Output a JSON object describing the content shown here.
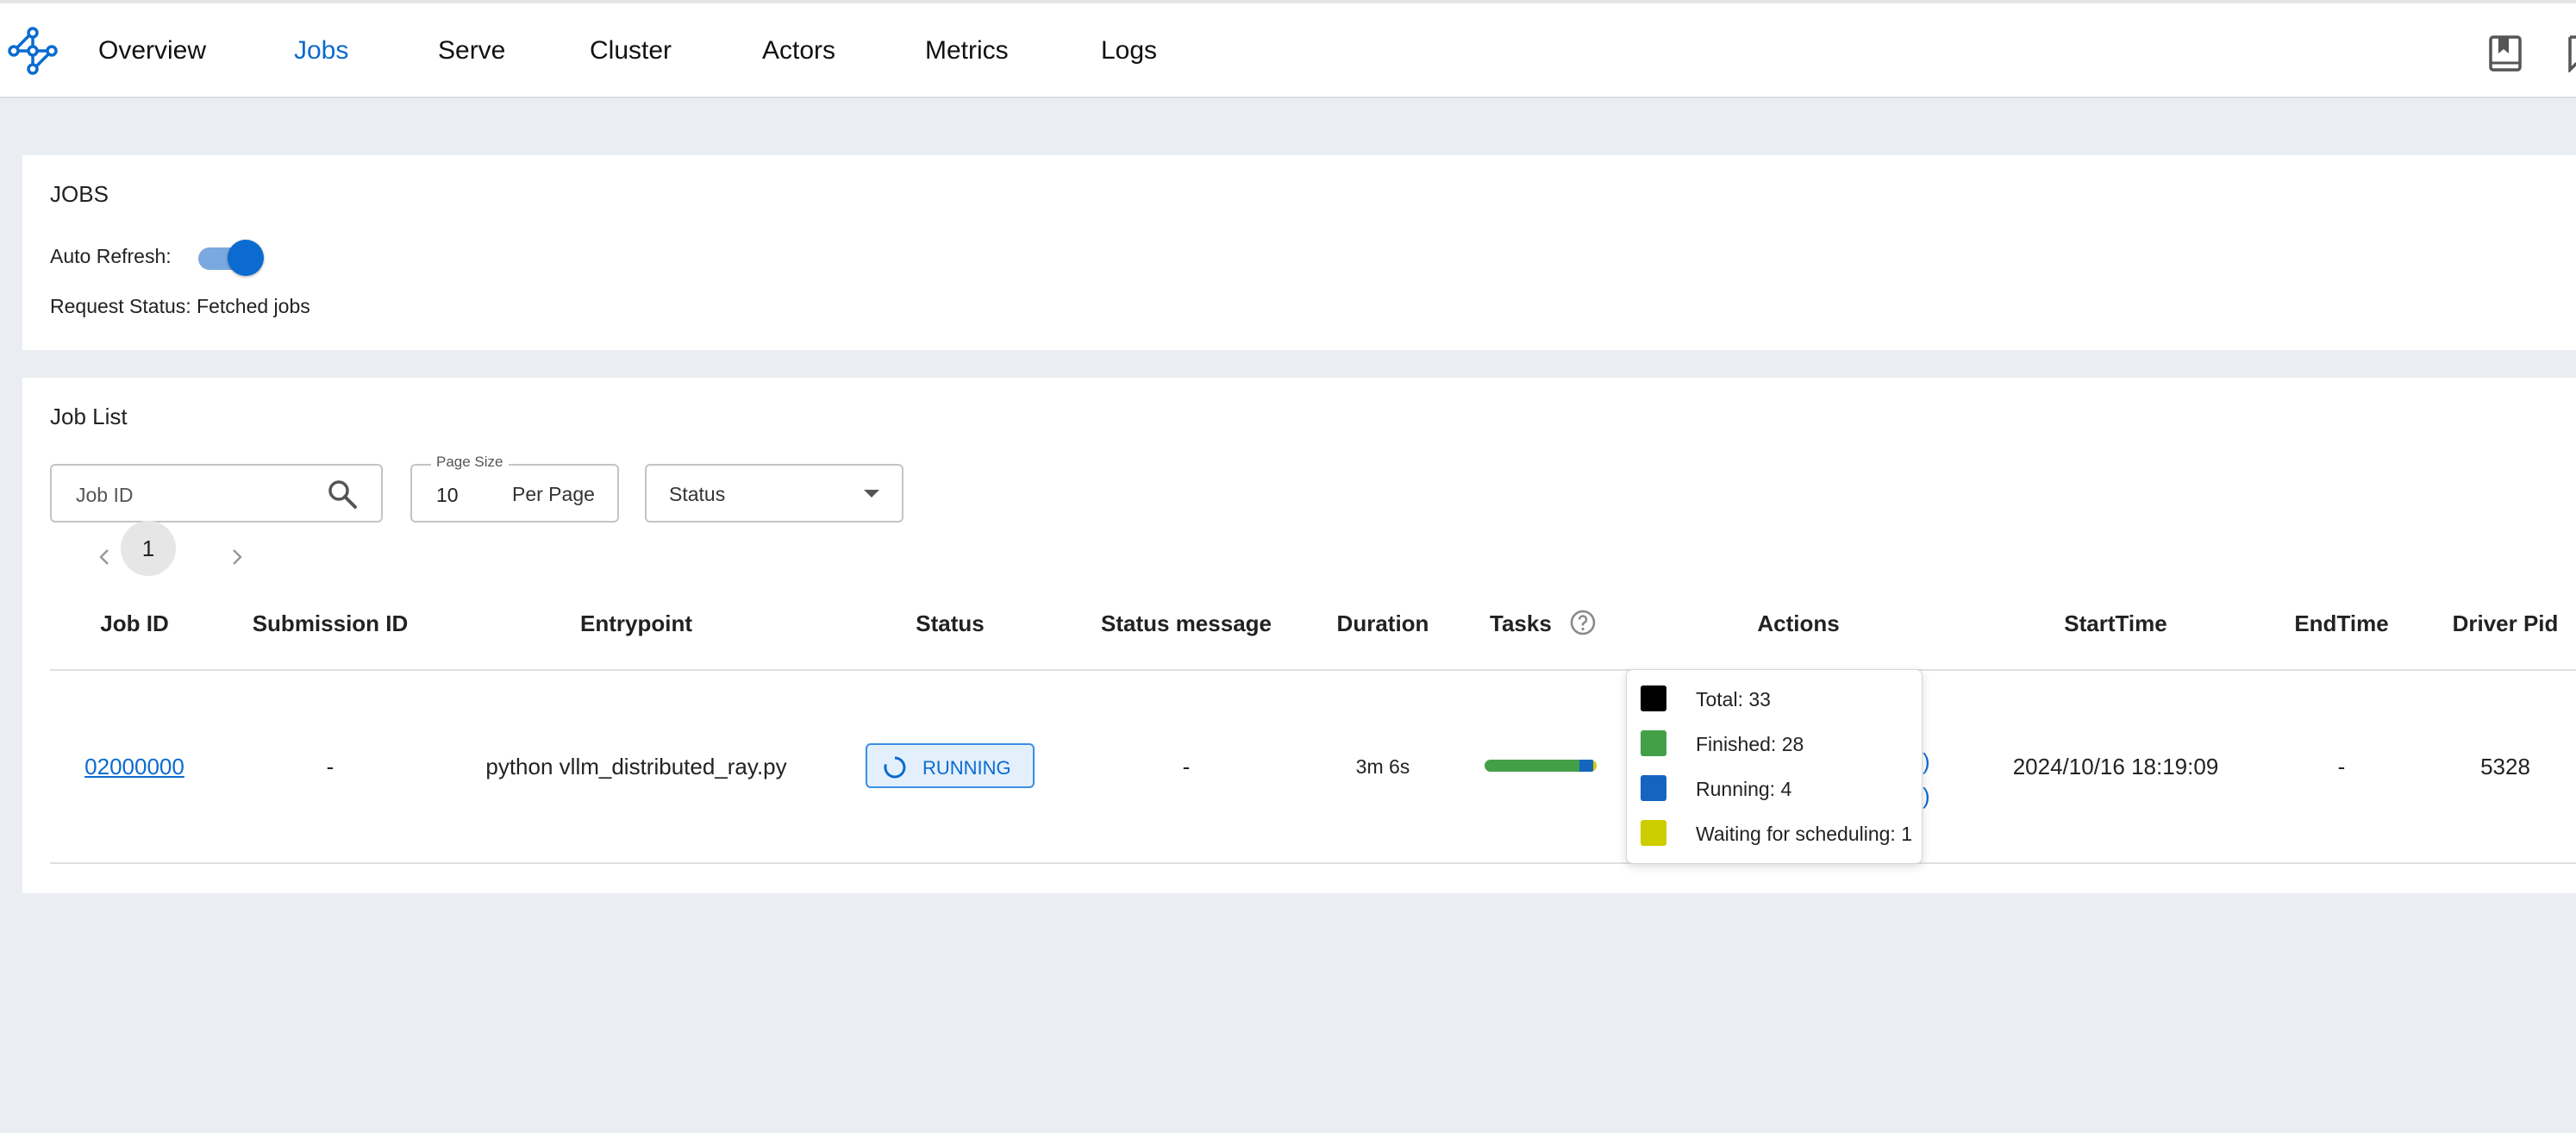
{
  "nav": {
    "items": [
      {
        "label": "Overview",
        "active": false
      },
      {
        "label": "Jobs",
        "active": true
      },
      {
        "label": "Serve",
        "active": false
      },
      {
        "label": "Cluster",
        "active": false
      },
      {
        "label": "Actors",
        "active": false
      },
      {
        "label": "Metrics",
        "active": false
      },
      {
        "label": "Logs",
        "active": false
      }
    ],
    "icons": [
      "ray-logo-icon",
      "docs-book-icon",
      "feedback-icon"
    ]
  },
  "jobs_card": {
    "title": "JOBS",
    "auto_refresh_label": "Auto Refresh:",
    "auto_refresh_on": true,
    "request_status": "Request Status: Fetched jobs"
  },
  "job_list": {
    "title": "Job List",
    "filters": {
      "job_id_placeholder": "Job ID",
      "page_size_label": "Page Size",
      "page_size_value": "10",
      "per_page_label": "Per Page",
      "status_label": "Status"
    },
    "pagination": {
      "current_page": "1"
    },
    "columns": [
      "Job ID",
      "Submission ID",
      "Entrypoint",
      "Status",
      "Status message",
      "Duration",
      "Tasks",
      "Actions",
      "StartTime",
      "EndTime",
      "Driver Pid"
    ],
    "rows": [
      {
        "job_id": "02000000",
        "submission_id": "-",
        "entrypoint": "python vllm_distributed_ray.py",
        "status": "RUNNING",
        "status_message": "-",
        "duration": "3m 6s",
        "start_time": "2024/10/16 18:19:09",
        "end_time": "-",
        "driver_pid": "5328",
        "tasks": {
          "total": 33,
          "finished": 28,
          "running": 4,
          "waiting": 1
        }
      }
    ]
  },
  "tooltip": {
    "rows": [
      {
        "label": "Total: 33",
        "color": "#000000"
      },
      {
        "label": "Finished: 28",
        "color": "#43a047"
      },
      {
        "label": "Running: 4",
        "color": "#1565c0"
      },
      {
        "label": "Waiting for scheduling: 1",
        "color": "#cdcd00"
      }
    ]
  },
  "colors": {
    "accent": "#0b6bd0",
    "finished": "#43a047",
    "running": "#1565c0",
    "waiting": "#cdcd00"
  }
}
